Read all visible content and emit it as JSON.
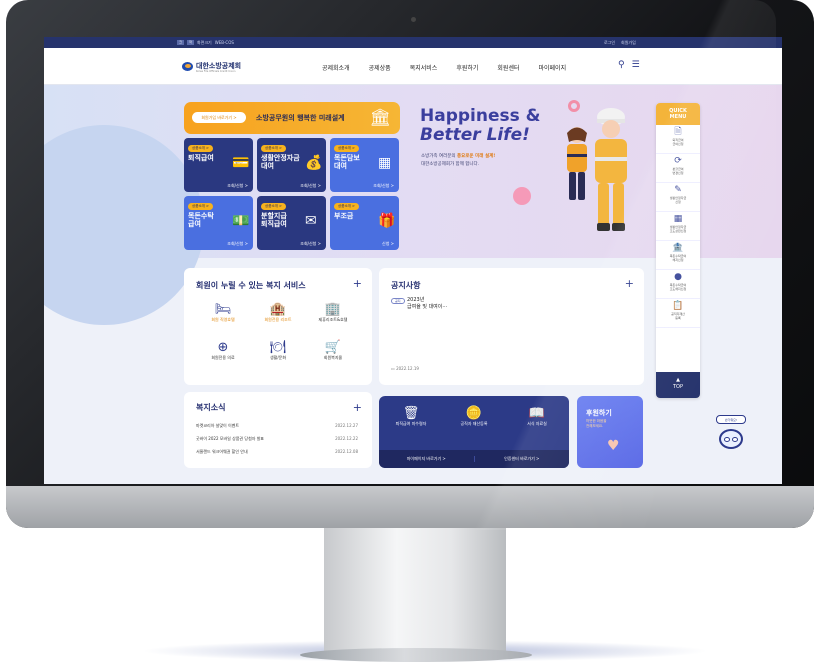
{
  "topbar": {
    "btn1": "크",
    "btn2": "작",
    "links": [
      "화면크기",
      "WEB-COS"
    ],
    "right": [
      "로그인",
      "회원가입"
    ]
  },
  "header": {
    "logo_text": "대한소방공제회",
    "logo_sub": "Korea Fire Officials Credit Union",
    "menu": [
      "공제회소개",
      "공제상품",
      "복지서비스",
      "후원하기",
      "회원센터",
      "마이페이지"
    ]
  },
  "hero": {
    "banner": {
      "pill": "회원가입 바로가기 >",
      "text": "소방공무원의 행복한 미래설계"
    },
    "tiles": [
      {
        "badge": "상품소개 >",
        "name": "퇴직급여",
        "link": "조회/신청 >"
      },
      {
        "badge": "상품소개 >",
        "name": "생활안정자금\n대여",
        "link": "조회/신청 >"
      },
      {
        "badge": "상품소개 >",
        "name": "목돈담보\n대여",
        "link": "조회/신청 >"
      },
      {
        "badge": "상품소개 >",
        "name": "목돈수탁\n급여",
        "link": "조회/신청 >"
      },
      {
        "badge": "상품소개 >",
        "name": "분할지급\n퇴직급여",
        "link": "조회/신청 >"
      },
      {
        "badge": "상품소개 >",
        "name": "부조금",
        "link": "신청 >"
      }
    ],
    "headline_line1": "Happiness &",
    "headline_line2": "Better Life!",
    "desc_pre": "소방가족 여러분의 ",
    "desc_highlight": "풍요로운 미래 설계!",
    "desc_line2": "대한소방공제회가 함께 합니다."
  },
  "quick_menu": {
    "title": "QUICK\nMENU",
    "items": [
      "퇴직급여\n급여신청",
      "분할급여\n변경신청",
      "생활안정자금\n신청",
      "생활안정자금\n조도상환신청",
      "목돈수탁급여\n해지신청",
      "목돈수탁급여\n조도해지신청",
      "공직자재산\n등록"
    ],
    "top": "TOP"
  },
  "welfare": {
    "title": "회원이 누릴 수 있는 복지 서비스",
    "items": [
      "회원 직영호텔",
      "회원전용 리조트",
      "제휴리조트&호텔",
      "회원전용 의료",
      "생활/문화",
      "회원복지몰"
    ]
  },
  "notice": {
    "title": "공지사항",
    "tag": "공지",
    "text": "2023년\n급여율 및 대여이···",
    "date": "2022.12.19"
  },
  "news": {
    "title": "복지소식",
    "rows": [
      {
        "t": "마켓코리아 설맞이 이벤트",
        "d": "2022.12.27"
      },
      {
        "t": "굿바이 2022 모바일 상품권 당첨자 발표",
        "d": "2022.12.22"
      },
      {
        "t": "서울랜드 워크어웨권 할인 안내",
        "d": "2022.12.08"
      }
    ]
  },
  "services": {
    "items": [
      "퇴직급여 미수령자",
      "공직자 재산등록",
      "서식 자료실"
    ],
    "links": [
      "마이페이지 바로가기 >",
      "인증센터 바로가기 >"
    ]
  },
  "support": {
    "title": "후원하기",
    "text": "따뜻한 마음을\n전해보세요."
  },
  "chatbot": {
    "bubble": "반가워요!"
  }
}
